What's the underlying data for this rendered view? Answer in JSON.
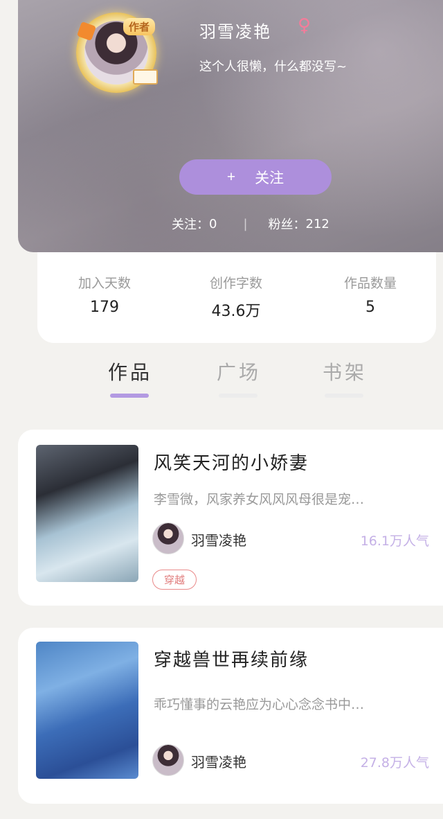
{
  "profile": {
    "username": "羽雪凌艳",
    "gender_symbol": "♀",
    "bio": "这个人很懒，什么都没写~",
    "author_badge": "作者",
    "follow_plus": "+",
    "follow_label": "关注",
    "following_label": "关注：",
    "following_count": "0",
    "separator": "|",
    "fans_label": "粉丝：",
    "fans_count": "212"
  },
  "stats": [
    {
      "label": "加入天数",
      "value": "179"
    },
    {
      "label": "创作字数",
      "value": "43.6万"
    },
    {
      "label": "作品数量",
      "value": "5"
    }
  ],
  "tabs": [
    {
      "label": "作品",
      "active": true
    },
    {
      "label": "广场",
      "active": false
    },
    {
      "label": "书架",
      "active": false
    }
  ],
  "books": [
    {
      "title": "风笑天河的小娇妻",
      "desc": "李雪微，风家养女风风风母很是宠…",
      "author": "羽雪凌艳",
      "popularity": "16.1万人气",
      "tag": "穿越"
    },
    {
      "title": "穿越兽世再续前缘",
      "desc": "乖巧懂事的云艳应为心心念念书中…",
      "author": "羽雪凌艳",
      "popularity": "27.8万人气"
    }
  ],
  "colors": {
    "accent": "#ad8fdc",
    "tab_active_underline": "#b39ae2",
    "popularity": "#c4b0e6",
    "tag": "#e07b7b",
    "gender": "#f47c9a"
  }
}
